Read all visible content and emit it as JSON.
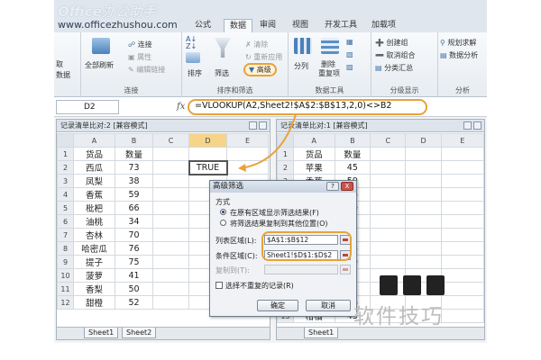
{
  "watermark": {
    "site": "Office办公助手",
    "url": "www.officezhushou.com",
    "brand_cn": "软件技巧"
  },
  "tabs": [
    "公式",
    "数据",
    "审阅",
    "视图",
    "开发工具",
    "加载项"
  ],
  "active_tab": "数据",
  "ribbon": {
    "get_data": {
      "label1": "取",
      "label2": "数据"
    },
    "connections": {
      "refresh": "全部刷新",
      "connect": "连接",
      "properties": "属性",
      "edit_links": "编辑链接",
      "group": "连接"
    },
    "sort_filter": {
      "sort": "排序",
      "filter": "筛选",
      "clear": "清除",
      "reapply": "重新应用",
      "advanced": "高级",
      "group": "排序和筛选"
    },
    "data_tools": {
      "split": "分列",
      "remove_dup": "删除",
      "dup": "重复项",
      "group": "数据工具"
    },
    "outline": {
      "create_group": "创建组",
      "ungroup": "取消组合",
      "subtotal": "分类汇总",
      "group": "分级显示"
    },
    "analysis": {
      "solver": "规划求解",
      "data_analysis": "数据分析",
      "group": "分析"
    }
  },
  "formula_bar": {
    "cell": "D2",
    "fx": "fx",
    "formula": "=VLOOKUP(A2,Sheet2!$A$2:$B$13,2,0)<>B2"
  },
  "left_pane": {
    "title": "记录清单比对:2 [兼容模式]",
    "cols": [
      "A",
      "B",
      "C",
      "D",
      "E"
    ],
    "rows": [
      [
        "1",
        "货品",
        "数量",
        "",
        "",
        ""
      ],
      [
        "2",
        "西瓜",
        "73",
        "",
        "TRUE",
        ""
      ],
      [
        "3",
        "凤梨",
        "38",
        "",
        "",
        ""
      ],
      [
        "4",
        "香蕉",
        "59",
        "",
        "",
        ""
      ],
      [
        "5",
        "枇杷",
        "66",
        "",
        "",
        ""
      ],
      [
        "6",
        "油桃",
        "34",
        "",
        "",
        ""
      ],
      [
        "7",
        "杏林",
        "70",
        "",
        "",
        ""
      ],
      [
        "8",
        "哈密瓜",
        "76",
        "",
        "",
        ""
      ],
      [
        "9",
        "提子",
        "75",
        "",
        "",
        ""
      ],
      [
        "10",
        "菠萝",
        "41",
        "",
        "",
        ""
      ],
      [
        "11",
        "香梨",
        "50",
        "",
        "",
        ""
      ],
      [
        "12",
        "甜橙",
        "52",
        "",
        "",
        ""
      ]
    ],
    "sheets": [
      "Sheet1",
      "Sheet2"
    ]
  },
  "right_pane": {
    "title": "记录清单比对:1 [兼容模式]",
    "cols": [
      "A",
      "B",
      "C",
      "D",
      "E"
    ],
    "rows": [
      [
        "1",
        "货品",
        "数量",
        "",
        "",
        ""
      ],
      [
        "2",
        "苹果",
        "45",
        "",
        "",
        ""
      ],
      [
        "3",
        "香蕉",
        "59",
        "",
        "",
        ""
      ],
      [
        "4",
        "荔枝",
        "76",
        "",
        "",
        ""
      ],
      [
        "5",
        "香梨",
        "50",
        "",
        "",
        ""
      ],
      [
        "6",
        "葡萄",
        "72",
        "",
        "",
        ""
      ],
      [
        "7",
        "西瓜",
        "45",
        "",
        "",
        ""
      ],
      [
        "8",
        "凤梨",
        "38",
        "",
        "",
        ""
      ],
      [
        "9",
        "杏林",
        "70",
        "",
        "",
        ""
      ],
      [
        "10",
        "提子",
        "75",
        "",
        "",
        ""
      ],
      [
        "11",
        "菠萝",
        "72",
        "",
        "",
        ""
      ],
      [
        "12",
        "哈密瓜",
        "76",
        "",
        "",
        ""
      ],
      [
        "13",
        "柑橘",
        "45",
        "",
        "",
        ""
      ]
    ],
    "sheets": [
      "Sheet1"
    ]
  },
  "dialog": {
    "title": "高级筛选",
    "help": "?",
    "close": "X",
    "method_label": "方式",
    "opt_in_place": "在原有区域显示筛选结果(F)",
    "opt_copy": "将筛选结果复制到其他位置(O)",
    "list_range_label": "列表区域(L):",
    "list_range_value": "$A$1:$B$12",
    "criteria_label": "条件区域(C):",
    "criteria_value": "Sheet1!$D$1:$D$2",
    "copy_to_label": "复制到(T):",
    "unique_label": "选择不重复的记录(R)",
    "ok": "确定",
    "cancel": "取消"
  }
}
